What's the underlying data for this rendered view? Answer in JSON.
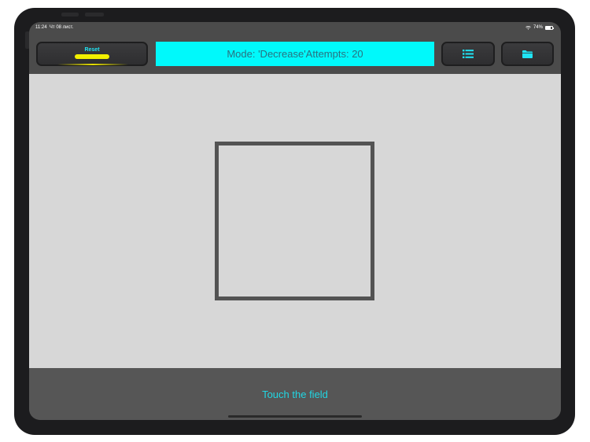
{
  "status_bar": {
    "time": "11:24",
    "date": "Чт 08 лист.",
    "battery_percent": "74%",
    "battery_level": 0.74
  },
  "toolbar": {
    "reset_label": "Reset",
    "mode_text": "Mode: 'Decrease'",
    "attempts_text": "Attempts: 20",
    "list_icon": "list-icon",
    "folder_icon": "folder-icon"
  },
  "footer": {
    "hint": "Touch the field"
  },
  "colors": {
    "accent": "#00f9fb",
    "reset_bar": "#f2f000",
    "field_bg": "#d7d7d7",
    "frame": "#535353"
  }
}
